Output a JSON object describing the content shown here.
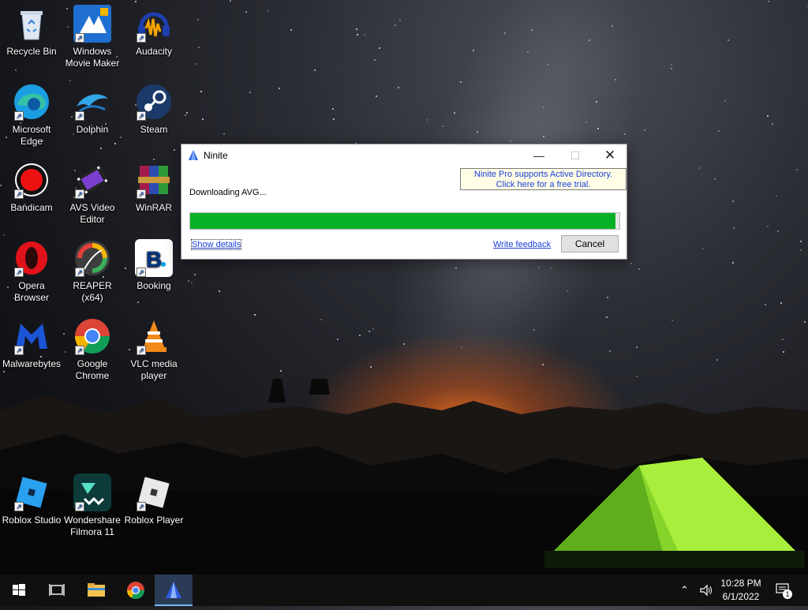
{
  "desktop": {
    "icons": [
      {
        "id": "recycle-bin",
        "label": "Recycle Bin"
      },
      {
        "id": "windows-movie-maker",
        "label": "Windows Movie Maker"
      },
      {
        "id": "audacity",
        "label": "Audacity"
      },
      {
        "id": "microsoft-edge",
        "label": "Microsoft Edge"
      },
      {
        "id": "dolphin",
        "label": "Dolphin"
      },
      {
        "id": "steam",
        "label": "Steam"
      },
      {
        "id": "bandicam",
        "label": "Bandicam"
      },
      {
        "id": "avs-video-editor",
        "label": "AVS Video Editor"
      },
      {
        "id": "winrar",
        "label": "WinRAR"
      },
      {
        "id": "opera-browser",
        "label": "Opera Browser"
      },
      {
        "id": "reaper",
        "label": "REAPER (x64)"
      },
      {
        "id": "booking",
        "label": "Booking"
      },
      {
        "id": "malwarebytes",
        "label": "Malwarebytes"
      },
      {
        "id": "google-chrome",
        "label": "Google Chrome"
      },
      {
        "id": "vlc-media-player",
        "label": "VLC media player"
      },
      {
        "id": "roblox-studio",
        "label": "Roblox Studio"
      },
      {
        "id": "wondershare-filmora",
        "label": "Wondershare Filmora 11"
      },
      {
        "id": "roblox-player",
        "label": "Roblox Player"
      }
    ]
  },
  "ninite": {
    "title": "Ninite",
    "ad_line1": "Ninite Pro supports Active Directory.",
    "ad_line2": "Click here for a free trial.",
    "status": "Downloading AVG...",
    "progress": 0.99,
    "show_details": "Show details",
    "write_feedback": "Write feedback",
    "cancel": "Cancel",
    "minimize_icon": "minimize-icon",
    "maximize_icon": "maximize-icon",
    "close_icon": "close-icon"
  },
  "taskbar": {
    "items": [
      "start-icon",
      "task-view-icon",
      "file-explorer-icon",
      "chrome-icon",
      "ninite-icon"
    ],
    "time": "10:28 PM",
    "date": "6/1/2022",
    "notification_count": "1"
  }
}
